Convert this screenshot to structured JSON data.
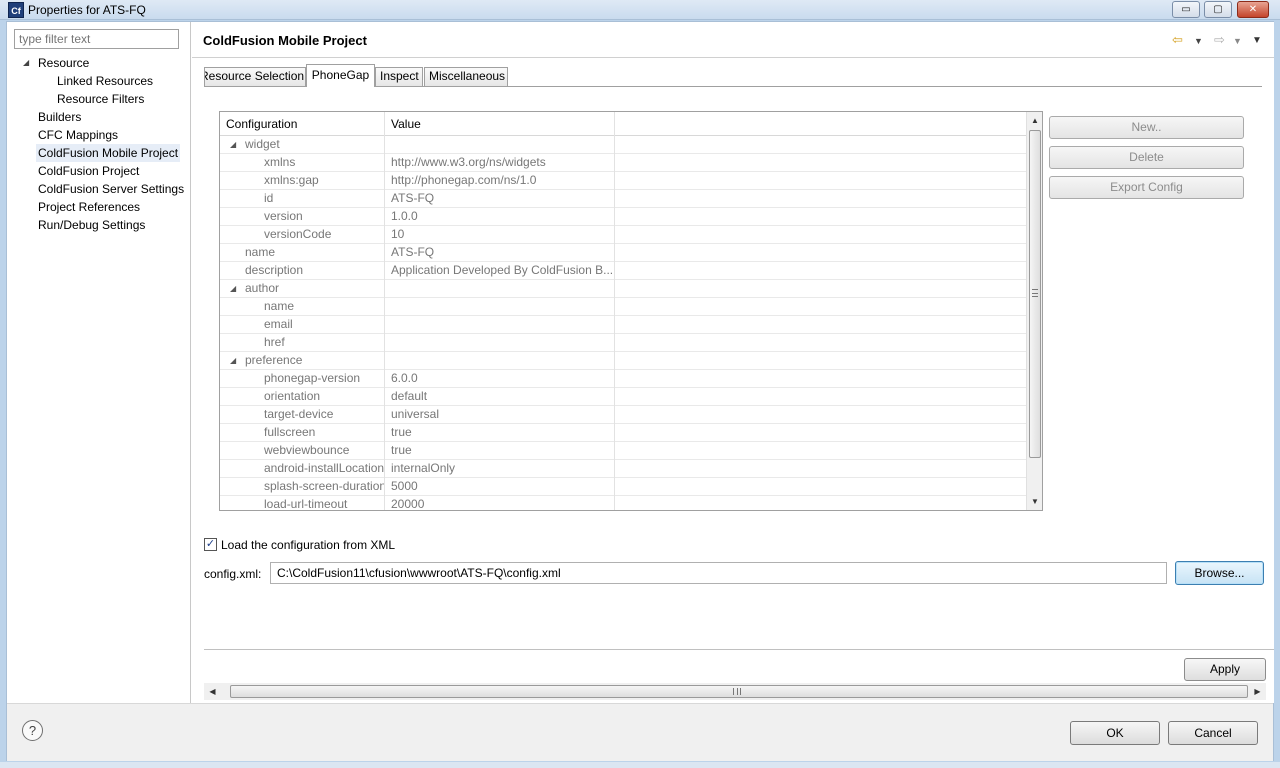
{
  "window": {
    "title": "Properties for ATS-FQ",
    "app_icon": "Cf",
    "min_glyph": "▭",
    "max_glyph": "▢",
    "close_glyph": "✕"
  },
  "sidebar": {
    "filter_placeholder": "type filter text",
    "items": [
      {
        "label": "Resource",
        "level": 0,
        "expanded": true
      },
      {
        "label": "Linked Resources",
        "level": 1
      },
      {
        "label": "Resource Filters",
        "level": 1
      },
      {
        "label": "Builders",
        "level": 0
      },
      {
        "label": "CFC Mappings",
        "level": 0
      },
      {
        "label": "ColdFusion Mobile Project",
        "level": 0,
        "selected": true
      },
      {
        "label": "ColdFusion Project",
        "level": 0
      },
      {
        "label": "ColdFusion Server Settings",
        "level": 0
      },
      {
        "label": "Project References",
        "level": 0
      },
      {
        "label": "Run/Debug Settings",
        "level": 0
      }
    ]
  },
  "page": {
    "title": "ColdFusion Mobile Project"
  },
  "tabs": [
    {
      "label": "Resource Selection",
      "active": false
    },
    {
      "label": "PhoneGap",
      "active": true
    },
    {
      "label": "Inspect",
      "active": false
    },
    {
      "label": "Miscellaneous",
      "active": false
    }
  ],
  "table": {
    "columns": [
      "Configuration",
      "Value"
    ],
    "rows": [
      {
        "key": "widget",
        "value": "",
        "depth": 1,
        "expandable": true
      },
      {
        "key": "xmlns",
        "value": "http://www.w3.org/ns/widgets",
        "depth": 2
      },
      {
        "key": "xmlns:gap",
        "value": "http://phonegap.com/ns/1.0",
        "depth": 2
      },
      {
        "key": "id",
        "value": "ATS-FQ",
        "depth": 2
      },
      {
        "key": "version",
        "value": "1.0.0",
        "depth": 2
      },
      {
        "key": "versionCode",
        "value": "10",
        "depth": 2
      },
      {
        "key": "name",
        "value": "ATS-FQ",
        "depth": 1
      },
      {
        "key": "description",
        "value": "Application Developed By ColdFusion B...",
        "depth": 1
      },
      {
        "key": "author",
        "value": "",
        "depth": 1,
        "expandable": true
      },
      {
        "key": "name",
        "value": "",
        "depth": 2
      },
      {
        "key": "email",
        "value": "",
        "depth": 2
      },
      {
        "key": "href",
        "value": "",
        "depth": 2
      },
      {
        "key": "preference",
        "value": "",
        "depth": 1,
        "expandable": true
      },
      {
        "key": "phonegap-version",
        "value": "6.0.0",
        "depth": 2
      },
      {
        "key": "orientation",
        "value": "default",
        "depth": 2
      },
      {
        "key": "target-device",
        "value": "universal",
        "depth": 2
      },
      {
        "key": "fullscreen",
        "value": "true",
        "depth": 2
      },
      {
        "key": "webviewbounce",
        "value": "true",
        "depth": 2
      },
      {
        "key": "android-installLocation",
        "value": "internalOnly",
        "depth": 2
      },
      {
        "key": "splash-screen-duration",
        "value": "5000",
        "depth": 2
      },
      {
        "key": "load-url-timeout",
        "value": "20000",
        "depth": 2
      }
    ]
  },
  "side_buttons": {
    "new": "New..",
    "delete": "Delete",
    "export": "Export Config"
  },
  "load_xml": {
    "checked": true,
    "check_glyph": "✓",
    "label": "Load the configuration from XML"
  },
  "config": {
    "label": "config.xml:",
    "value": "C:\\ColdFusion11\\cfusion\\wwwroot\\ATS-FQ\\config.xml",
    "browse": "Browse..."
  },
  "apply_label": "Apply",
  "dialog": {
    "help_glyph": "?",
    "ok": "OK",
    "cancel": "Cancel"
  },
  "icons": {
    "expanded_arrow": "◢",
    "nav_back": "⇦",
    "nav_forward": "⇨",
    "dropdown": "▼",
    "scroll_up": "▲",
    "scroll_down": "▼",
    "scroll_left": "◀",
    "scroll_right": "▶"
  }
}
